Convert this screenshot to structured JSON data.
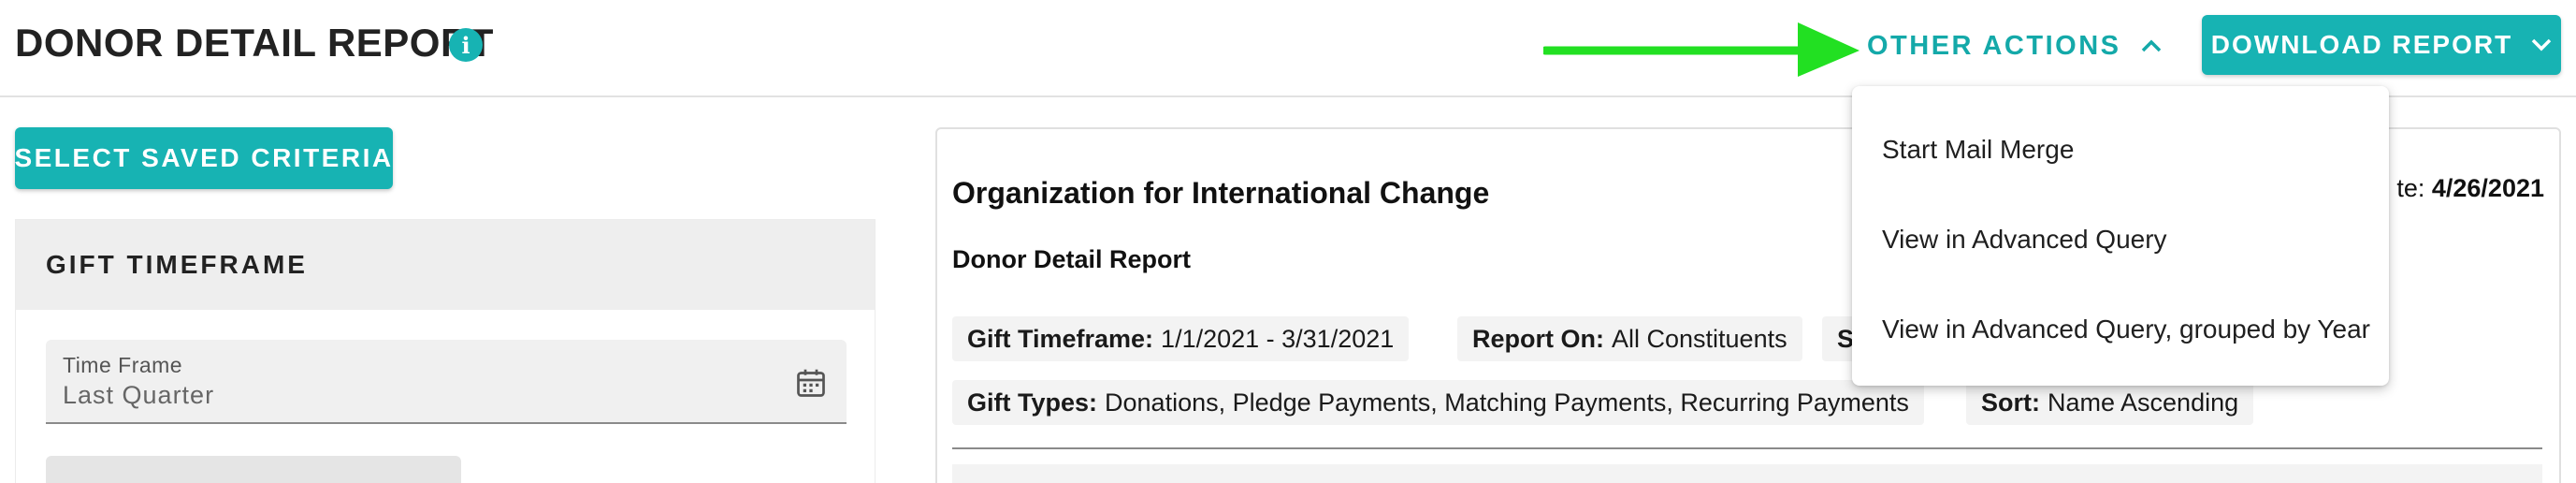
{
  "header": {
    "title": "DONOR DETAIL REPORT",
    "info_icon": "info-icon",
    "other_actions_label": "OTHER ACTIONS",
    "download_label": "DOWNLOAD REPORT"
  },
  "menu": {
    "items": [
      {
        "label": "Start Mail Merge"
      },
      {
        "label": "View in Advanced Query"
      },
      {
        "label": "View in Advanced Query, grouped by Year"
      }
    ]
  },
  "left_panel": {
    "select_saved_label": "SELECT SAVED CRITERIA",
    "gift_timeframe_heading": "GIFT TIMEFRAME",
    "time_frame": {
      "label": "Time Frame",
      "value": "Last Quarter",
      "icon": "calendar-icon"
    }
  },
  "report": {
    "org_name": "Organization for International Change",
    "date_label_fragment": "te:",
    "date_value": "4/26/2021",
    "subtitle": "Donor Detail Report",
    "chips": [
      {
        "key": "Gift Timeframe:",
        "value": "1/1/2021 - 3/31/2021"
      },
      {
        "key": "Report On:",
        "value": "All Constituents"
      },
      {
        "key": "S",
        "value": ""
      },
      {
        "key": "Gift Types:",
        "value": "Donations, Pledge Payments, Matching Payments, Recurring Payments"
      },
      {
        "key": "Sort:",
        "value": "Name Ascending"
      }
    ]
  },
  "colors": {
    "accent": "#17b3b3",
    "arrow": "#22e022"
  }
}
